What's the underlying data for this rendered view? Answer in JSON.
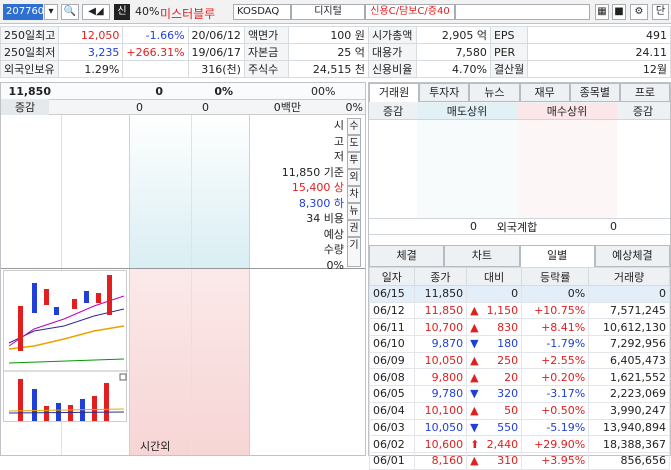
{
  "toolbar": {
    "code": "207760",
    "btn_shin": "신",
    "pct": "40%",
    "name": "미스터블루",
    "market": "KOSDAQ",
    "sector": "디지털",
    "credit": "신용C/담보C/증40",
    "btn_dan": "단"
  },
  "info": [
    [
      "250일최고",
      "12,050",
      "-1.66%",
      "20/06/12",
      "액면가",
      "100 원",
      "시가총액",
      "2,905 억",
      "EPS",
      "491"
    ],
    [
      "250일최저",
      "3,235",
      "+266.31%",
      "19/06/17",
      "자본금",
      "25 억",
      "대용가",
      "7,580",
      "PER",
      "24.11"
    ],
    [
      "외국인보유",
      "1.29%",
      "",
      "316(천)",
      "주식수",
      "24,515 천",
      "신용비율",
      "4.70%",
      "결산월",
      "12월"
    ]
  ],
  "quote": {
    "price": "11,850",
    "v1": "0",
    "v2": "0%",
    "v3": "0",
    "v4": "0%",
    "label_jg": "증감",
    "jg1": "0",
    "jg2": "0",
    "jg3": "0백만",
    "jg4": "0%"
  },
  "summary": {
    "si": "시",
    "go": "고",
    "jeo": "저",
    "base": "11,850 기준",
    "up": "15,400 상",
    "down": "8,300 하",
    "rate": "34 비용",
    "exp1": "예상",
    "exp2": "수량",
    "exp3": "0%",
    "timeout": "시간외"
  },
  "side_buttons": [
    "수",
    "도",
    "투",
    "외",
    "차",
    "뉴",
    "권",
    "기"
  ],
  "right_tabs": [
    "거래원",
    "투자자",
    "뉴스",
    "재무",
    "종목별",
    "프로"
  ],
  "broker": {
    "h1": "증감",
    "h2": "매도상위",
    "h3": "매수상위",
    "h4": "증감",
    "foreign": "외국계합",
    "f1": "0",
    "f2": "0"
  },
  "sub_tabs": [
    "체결",
    "차트",
    "일별",
    "예상체결"
  ],
  "daily": {
    "headers": [
      "일자",
      "종가",
      "대비",
      "등락률",
      "거래량"
    ],
    "rows": [
      [
        "06/15",
        "11,850",
        "",
        "0",
        "0%",
        "0"
      ],
      [
        "06/12",
        "11,850",
        "up",
        "1,150",
        "+10.75%",
        "7,571,245"
      ],
      [
        "06/11",
        "10,700",
        "up",
        "830",
        "+8.41%",
        "10,612,130"
      ],
      [
        "06/10",
        "9,870",
        "down",
        "180",
        "-1.79%",
        "7,292,956"
      ],
      [
        "06/09",
        "10,050",
        "up",
        "250",
        "+2.55%",
        "6,405,473"
      ],
      [
        "06/08",
        "9,800",
        "up",
        "20",
        "+0.20%",
        "1,621,552"
      ],
      [
        "06/05",
        "9,780",
        "down",
        "320",
        "-3.17%",
        "2,223,069"
      ],
      [
        "06/04",
        "10,100",
        "up",
        "50",
        "+0.50%",
        "3,990,247"
      ],
      [
        "06/03",
        "10,050",
        "down",
        "550",
        "-5.19%",
        "13,940,894"
      ],
      [
        "06/02",
        "10,600",
        "uu",
        "2,440",
        "+29.90%",
        "18,388,367"
      ],
      [
        "06/01",
        "8,160",
        "up",
        "310",
        "+3.95%",
        "856,656"
      ]
    ]
  }
}
